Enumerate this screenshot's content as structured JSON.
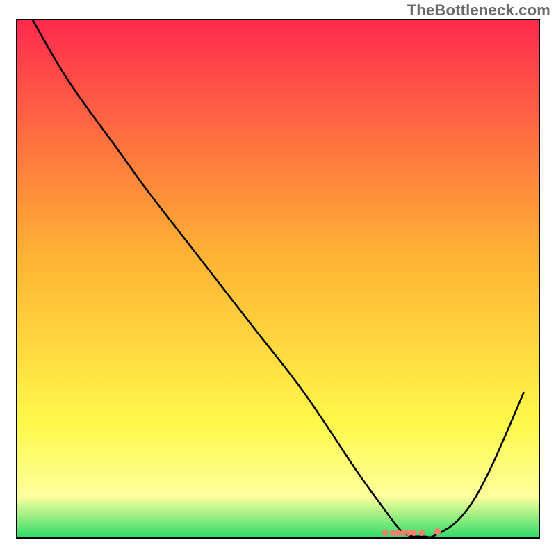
{
  "watermark": "TheBottleneck.com",
  "chart_data": {
    "type": "line",
    "title": "",
    "xlabel": "",
    "ylabel": "",
    "xlim": [
      0,
      100
    ],
    "ylim": [
      0,
      100
    ],
    "background_gradient": {
      "top": "#ff2a4e",
      "mid": "#ffb133",
      "lower_mid": "#fff94a",
      "near_bottom": "#fdff9c",
      "bottom": "#2edc67"
    },
    "series": [
      {
        "name": "bottleneck-curve",
        "x": [
          3,
          10,
          20,
          25,
          35,
          45,
          55,
          65,
          70,
          73,
          75,
          78,
          80,
          85,
          90,
          97
        ],
        "y": [
          100,
          88,
          74,
          67,
          54,
          41,
          28,
          13,
          6,
          2,
          0.5,
          0.3,
          0.5,
          4,
          12,
          28
        ]
      }
    ],
    "markers": {
      "name": "optimum-cluster",
      "color": "#f08070",
      "points": [
        {
          "x": 70.5,
          "y": 1.0
        },
        {
          "x": 72.0,
          "y": 1.0
        },
        {
          "x": 73.0,
          "y": 1.0
        },
        {
          "x": 74.0,
          "y": 1.0
        },
        {
          "x": 75.0,
          "y": 1.0
        },
        {
          "x": 76.0,
          "y": 1.0
        },
        {
          "x": 77.5,
          "y": 1.0
        },
        {
          "x": 80.5,
          "y": 1.2
        }
      ]
    },
    "frame": {
      "stroke": "#000000",
      "stroke_width": 2
    }
  }
}
